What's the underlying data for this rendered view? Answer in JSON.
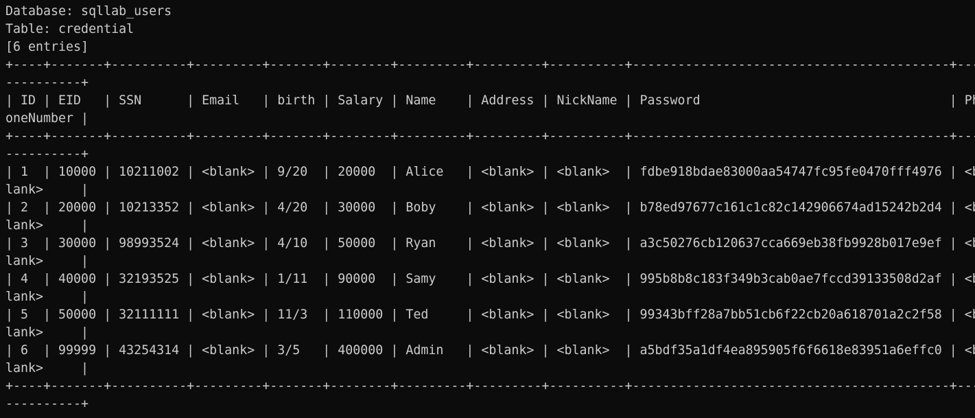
{
  "terminal": {
    "lines": [
      "Database: sqllab_users",
      "Table: credential",
      "[6 entries]",
      "+----+-------+----------+---------+-------+--------+---------+---------+----------+------------------------------------------+---",
      "----------+",
      "| ID | EID   | SSN      | Email   | birth | Salary | Name    | Address | NickName | Password                                 | Ph",
      "oneNumber |",
      "+----+-------+----------+---------+-------+--------+---------+---------+----------+------------------------------------------+---",
      "----------+",
      "| 1  | 10000 | 10211002 | <blank> | 9/20  | 20000  | Alice   | <blank> | <blank>  | fdbe918bdae83000aa54747fc95fe0470fff4976 | <b",
      "lank>     |",
      "| 2  | 20000 | 10213352 | <blank> | 4/20  | 30000  | Boby    | <blank> | <blank>  | b78ed97677c161c1c82c142906674ad15242b2d4 | <b",
      "lank>     |",
      "| 3  | 30000 | 98993524 | <blank> | 4/10  | 50000  | Ryan    | <blank> | <blank>  | a3c50276cb120637cca669eb38fb9928b017e9ef | <b",
      "lank>     |",
      "| 4  | 40000 | 32193525 | <blank> | 1/11  | 90000  | Samy    | <blank> | <blank>  | 995b8b8c183f349b3cab0ae7fccd39133508d2af | <b",
      "lank>     |",
      "| 5  | 50000 | 32111111 | <blank> | 11/3  | 110000 | Ted     | <blank> | <blank>  | 99343bff28a7bb51cb6f22cb20a618701a2c2f58 | <b",
      "lank>     |",
      "| 6  | 99999 | 43254314 | <blank> | 3/5   | 400000 | Admin   | <blank> | <blank>  | a5bdf35a1df4ea895905f6f6618e83951a6effc0 | <b",
      "lank>     |",
      "+----+-------+----------+---------+-------+--------+---------+---------+----------+------------------------------------------+---",
      "----------+"
    ]
  }
}
